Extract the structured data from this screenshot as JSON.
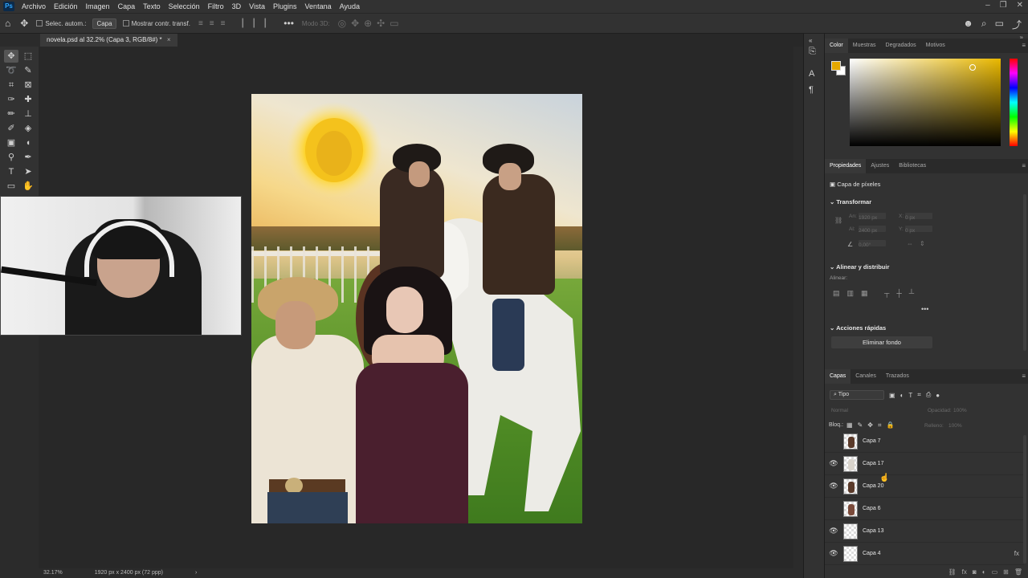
{
  "menubar": {
    "logo": "Ps",
    "items": [
      "Archivo",
      "Edición",
      "Imagen",
      "Capa",
      "Texto",
      "Selección",
      "Filtro",
      "3D",
      "Vista",
      "Plugins",
      "Ventana",
      "Ayuda"
    ]
  },
  "options": {
    "auto_select_label": "Selec. autom.:",
    "auto_select_value": "Capa",
    "transform_label": "Mostrar contr. transf.",
    "mode3d_label": "Modo 3D:"
  },
  "document": {
    "tab_title": "novela.psd al 32.2% (Capa 3, RGB/8#) *",
    "zoom": "32.17%",
    "doc_size": "1920 px x 2400 px (72 ppp)"
  },
  "color_panel": {
    "tabs": [
      "Color",
      "Muestras",
      "Degradados",
      "Motivos"
    ],
    "foreground": "#e6a800",
    "background": "#ffffff"
  },
  "properties_panel": {
    "tabs": [
      "Propiedades",
      "Ajustes",
      "Bibliotecas"
    ],
    "layer_type": "Capa de píxeles",
    "transform_title": "Transformar",
    "transform_fields": [
      "An:",
      "Al:",
      "X:",
      "Y:"
    ],
    "transform_values": [
      "1920 px",
      "2400 px",
      "0 px",
      "0 px",
      "0,00°"
    ],
    "align_title": "Alinear y distribuir",
    "align_label": "Alinear:",
    "quick_actions_title": "Acciones rápidas",
    "remove_bg_button": "Eliminar fondo"
  },
  "layers_panel": {
    "tabs": [
      "Capas",
      "Canales",
      "Trazados"
    ],
    "filter_label": "Tipo",
    "blend_mode": "Normal",
    "opacity_label": "Opacidad:",
    "opacity_value": "100%",
    "lock_label": "Bloq.:",
    "fill_label": "Relleno:",
    "fill_value": "100%",
    "layers": [
      {
        "name": "Capa 7",
        "visible": false
      },
      {
        "name": "Capa 17",
        "visible": true
      },
      {
        "name": "Capa 20",
        "visible": true
      },
      {
        "name": "Capa 6",
        "visible": false
      },
      {
        "name": "Capa 13",
        "visible": true
      },
      {
        "name": "Capa 4",
        "visible": true
      }
    ],
    "fx_label": "fx"
  }
}
